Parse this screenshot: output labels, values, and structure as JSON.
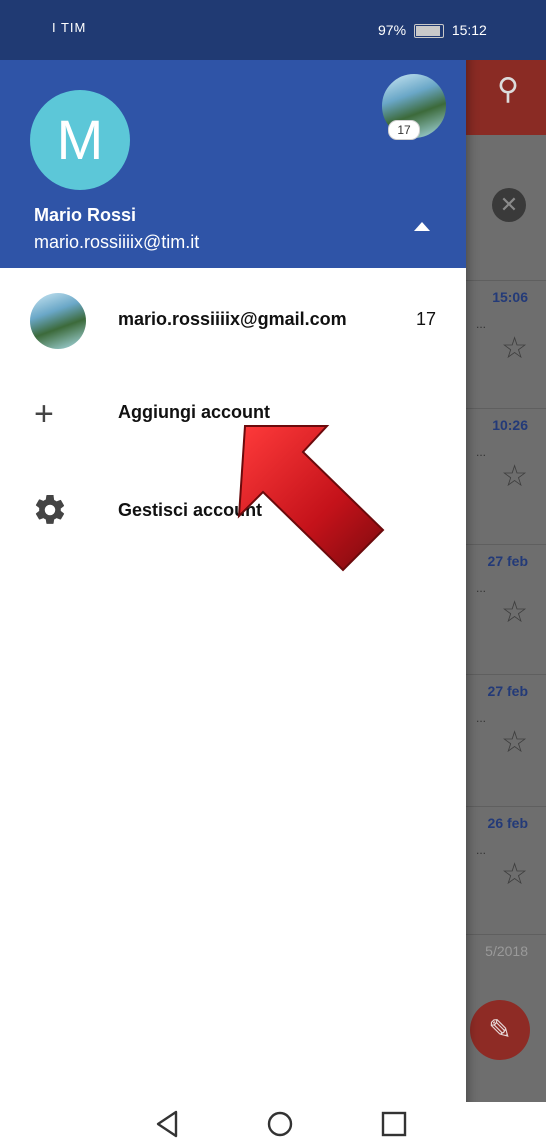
{
  "status_bar": {
    "carrier": "I TIM",
    "battery": "97%",
    "time": "15:12"
  },
  "drawer": {
    "avatar_letter": "M",
    "avatar_badge": "17",
    "user_name": "Mario Rossi",
    "user_email": "mario.rossiiiix@tim.it",
    "accounts": [
      {
        "email": "mario.rossiiiix@gmail.com",
        "count": "17"
      }
    ],
    "add_account_label": "Aggiungi account",
    "manage_accounts_label": "Gestisci account"
  },
  "inbox_rows": [
    {
      "time": "15:06"
    },
    {
      "time": "10:26"
    },
    {
      "time": "27 feb"
    },
    {
      "time": "27 feb"
    },
    {
      "time": "26 feb"
    },
    {
      "time": "5/2018"
    }
  ],
  "colors": {
    "header_blue": "#2f54a7",
    "status_blue": "#203a73",
    "avatar_cyan": "#5cc7d8",
    "arrow_red": "#c4121a"
  },
  "icons": [
    "search-icon",
    "close-icon",
    "star-icon",
    "pencil-icon",
    "plus-icon",
    "gear-icon",
    "back-icon",
    "home-icon",
    "recents-icon"
  ]
}
